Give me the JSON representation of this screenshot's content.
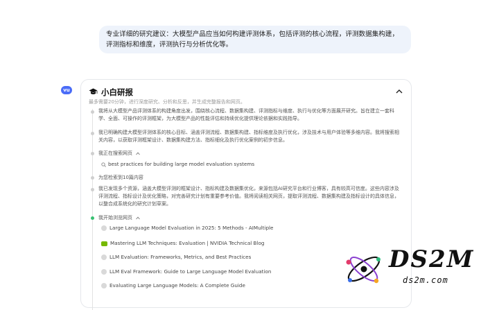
{
  "user_message": {
    "line1": "专业详细的研究建议：大模型产品应当如何构建评测体系，包括评测的核心流程，评测数据集构建，",
    "line2": "评测指标和维度，评测执行与分析优化等。"
  },
  "assistant": {
    "avatar_label": "vu",
    "card": {
      "title": "小白研报",
      "subtitle": "最多需要20分钟，进行深度研究、分析和反思，并生成完整报告和网页。",
      "steps": [
        {
          "text": "我将从大模型产品评测体系的构建角度出发，围绕核心流程、数据集构建、评测指标与维度、执行与优化等方面展开研究。旨在建立一套科学、全面、可操作的评测框架，为大模型产品的性能评估和持续优化提供理论依据和实践指导。"
        },
        {
          "text": "我已明确构建大模型评测体系的核心目标、涵盖评测流程、数据集构建、指标维度及执行优化，涉及技术与用户体验等多维内容。我将搜索相关内容，以获取评测框架设计、数据集构建方法、指标细化及执行优化案例的初步信息。"
        },
        {
          "label": "我正在搜索网页"
        },
        {
          "label": "为您检索到10篇内容"
        },
        {
          "text": "我已发现多个资源，涵盖大模型评测的框架设计、指标构建及数据集优化，来源包括AI研究平台和行业博客，具有较高可信度。这些内容涉及评测流程、指标设计及优化策略，对完善研究计划有重要参考价值。我将阅读相关网页，提取评测流程、数据集构建及指标设计的具体信息，以整合成系统化的研究计划草案。"
        },
        {
          "label": "我开始浏览网页"
        }
      ],
      "search_query": "best practices for building large model evaluation systems",
      "links": [
        {
          "title": "Large Language Model Evaluation in 2025: 5 Methods - AIMultiple",
          "icon": "globe-icon"
        },
        {
          "title": "Mastering LLM Techniques: Evaluation | NVIDIA Technical Blog",
          "icon": "nvidia-icon"
        },
        {
          "title": "LLM Evaluation: Frameworks, Metrics, and Best Practices",
          "icon": "globe-icon"
        },
        {
          "title": "LLM Eval Framework: Guide to Large Language Model Evaluation",
          "icon": "globe-icon"
        },
        {
          "title": "Evaluating Large Language Models: A Complete Guide",
          "icon": "globe-icon"
        }
      ]
    }
  },
  "watermark": {
    "brand": "DS2M",
    "url": "ds2m.com"
  },
  "colors": {
    "bubble_bg": "#eef3fb",
    "active_dot": "#38c172",
    "avatar": "#4a6cf7"
  }
}
